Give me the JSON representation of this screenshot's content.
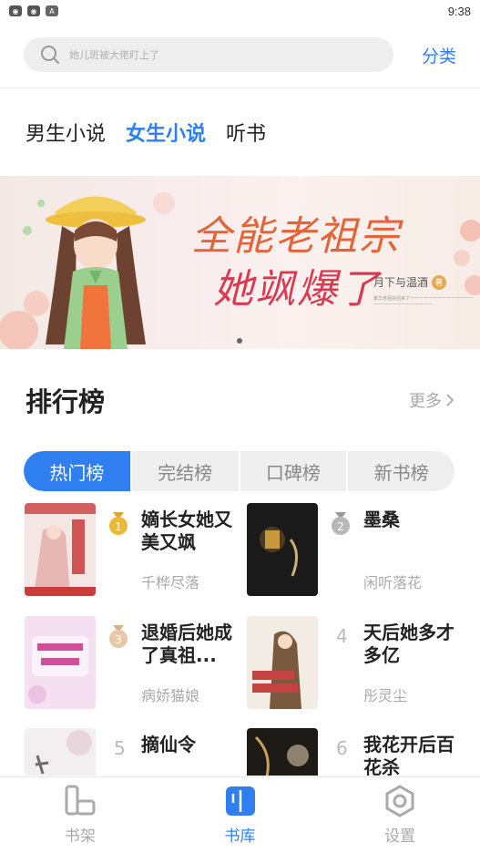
{
  "status": {
    "time": "9:38",
    "icons": [
      "app-icon-1",
      "app-icon-2",
      "a-icon"
    ]
  },
  "search": {
    "placeholder": "她儿斑被大佬盯上了"
  },
  "header": {
    "category_link": "分类"
  },
  "tabs": [
    {
      "label": "男生小说",
      "active": false
    },
    {
      "label": "女生小说",
      "active": true
    },
    {
      "label": "听书",
      "active": false
    }
  ],
  "banner": {
    "title_line1": "全能老祖宗",
    "title_line2": "她飒爆了",
    "author": "月下与温酒",
    "author_badge": "著",
    "blurb": "繁华老祖宗回来了一一一一一一一一一一一一一一一一一一一一一一一一一一一",
    "dots": 1
  },
  "ranking": {
    "title": "排行榜",
    "more": "更多",
    "segments": [
      {
        "label": "热门榜",
        "active": true
      },
      {
        "label": "完结榜",
        "active": false
      },
      {
        "label": "口碑榜",
        "active": false
      },
      {
        "label": "新书榜",
        "active": false
      }
    ],
    "books": [
      {
        "rank": "1",
        "name": "嫡长女她又美又飒",
        "author": "千桦尽落",
        "medal": "gold",
        "cover_color": "#f4e6e2",
        "cover_accent": "#c93c3c"
      },
      {
        "rank": "2",
        "name": "墨桑",
        "author": "闲听落花",
        "medal": "silver",
        "cover_color": "#1a1a1a",
        "cover_accent": "#d9a441"
      },
      {
        "rank": "3",
        "name": "退婚后她成了真祖...",
        "author": "病娇猫娘",
        "medal": "bronze",
        "cover_color": "#f4e0f0",
        "cover_accent": "#d24f9b"
      },
      {
        "rank": "4",
        "name": "天后她多才多亿",
        "author": "彤灵尘",
        "medal": "none",
        "cover_color": "#f2ece4",
        "cover_accent": "#c4423f"
      },
      {
        "rank": "5",
        "name": "摘仙令",
        "author": "",
        "medal": "none",
        "cover_color": "#f3eeef",
        "cover_accent": "#6b6b6b"
      },
      {
        "rank": "6",
        "name": "我花开后百花杀",
        "author": "",
        "medal": "none",
        "cover_color": "#1e1a16",
        "cover_accent": "#c9a45a"
      }
    ]
  },
  "bottom_nav": [
    {
      "label": "书架",
      "icon": "bookshelf-icon",
      "active": false
    },
    {
      "label": "书库",
      "icon": "library-icon",
      "active": true
    },
    {
      "label": "设置",
      "icon": "settings-icon",
      "active": false
    }
  ],
  "colors": {
    "accent": "#2f7ff0"
  }
}
